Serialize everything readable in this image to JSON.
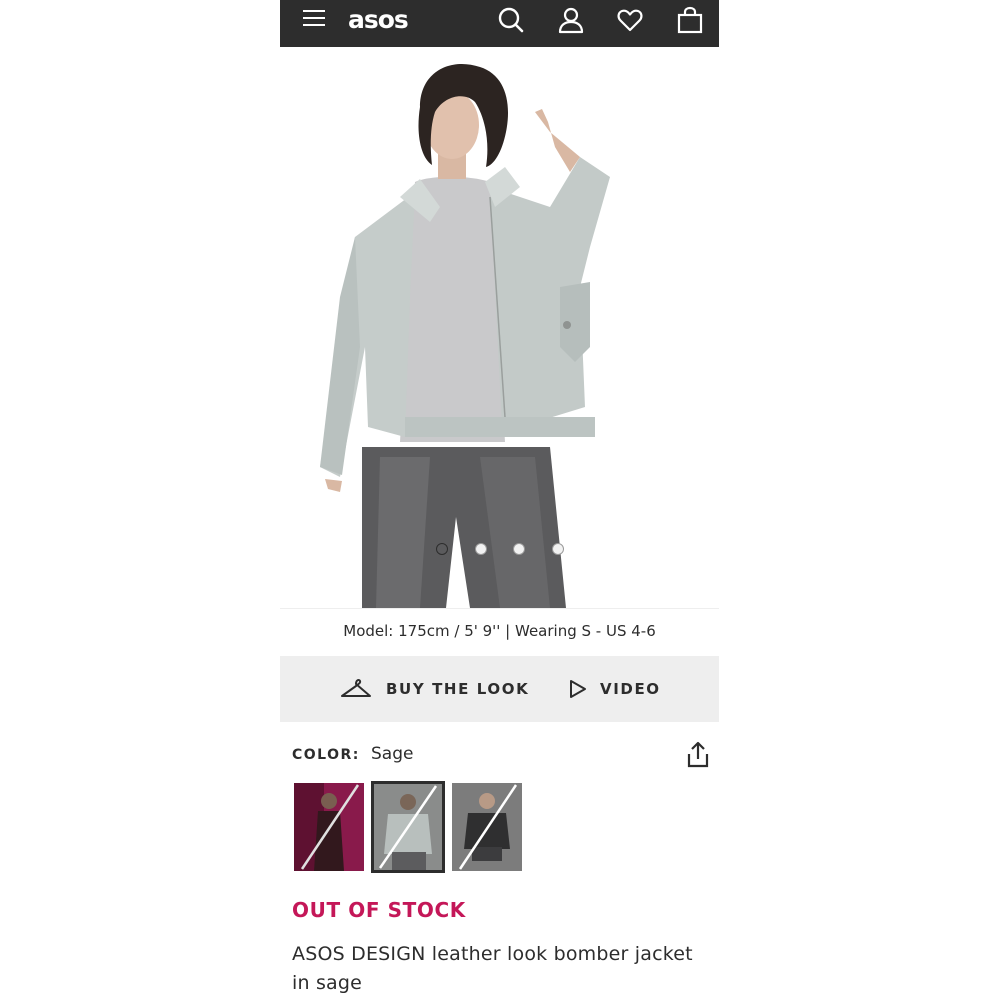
{
  "header": {
    "logo_text": "asos",
    "background": "#2d2d2d",
    "icons": [
      "menu-icon",
      "search-icon",
      "account-icon",
      "heart-icon",
      "bag-icon"
    ]
  },
  "gallery": {
    "slide_count": 4,
    "active_slide": 1
  },
  "model_info": "Model: 175cm / 5' 9'' | Wearing S - US 4-6",
  "actions": {
    "buy_the_look": "BUY THE LOOK",
    "video": "VIDEO"
  },
  "color": {
    "label": "COLOR:",
    "value": "Sage",
    "swatches": [
      {
        "name": "burgundy",
        "selected": false,
        "out_of_stock": true
      },
      {
        "name": "sage",
        "selected": true,
        "out_of_stock": true
      },
      {
        "name": "black",
        "selected": false,
        "out_of_stock": true
      }
    ]
  },
  "stock_status": "OUT OF STOCK",
  "product_title": "ASOS DESIGN leather look bomber jacket in sage",
  "colors": {
    "accent_out_of_stock": "#c41758",
    "text": "#2d2d2d",
    "action_bar_bg": "#eeeeee"
  }
}
